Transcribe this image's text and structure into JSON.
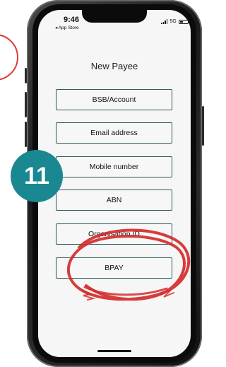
{
  "status_bar": {
    "time": "9:46",
    "back_label": "◂ App Store",
    "network": "5G"
  },
  "screen": {
    "title": "New Payee",
    "options": [
      {
        "label": "BSB/Account"
      },
      {
        "label": "Email address"
      },
      {
        "label": "Mobile number"
      },
      {
        "label": "ABN"
      },
      {
        "label": "Organisation ID"
      },
      {
        "label": "BPAY"
      }
    ]
  },
  "overlay": {
    "step_number": "11",
    "step_badge_color": "#1a8890",
    "highlight_color": "#d42b2b"
  },
  "colors": {
    "button_border": "#2d5a5a",
    "screen_background": "#f6f6f6"
  }
}
